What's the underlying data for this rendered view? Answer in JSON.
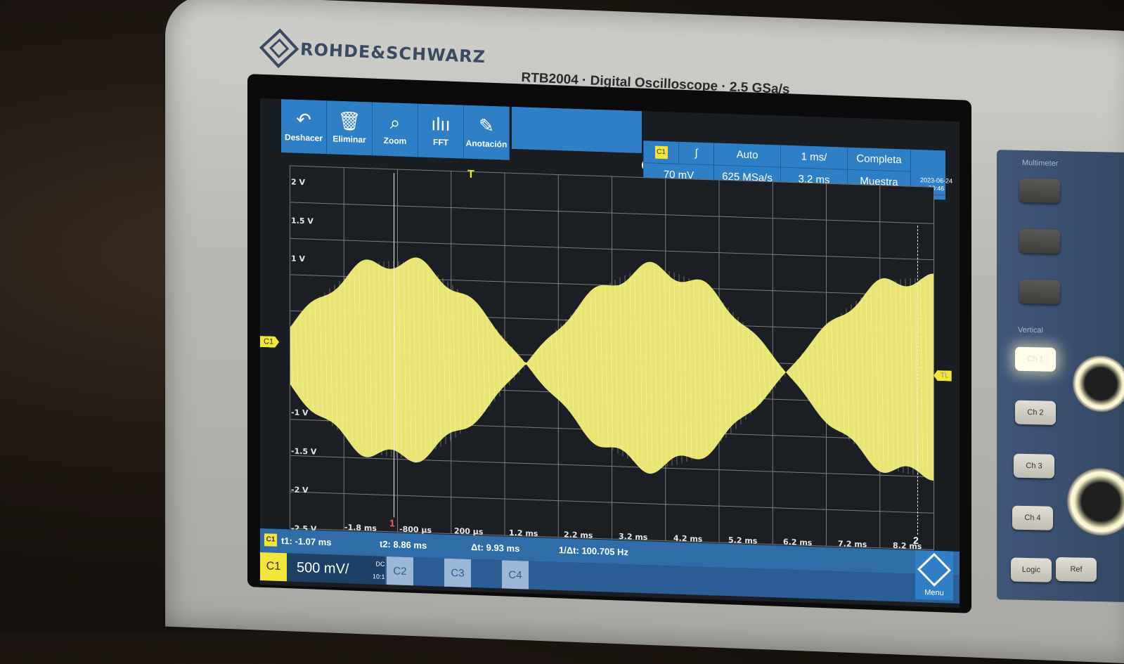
{
  "brand": {
    "name": "ROHDE&SCHWARZ",
    "model_line": "RTB2004 · Digital Oscilloscope · 2.5 GSa/s"
  },
  "toolbar": {
    "undo": {
      "label": "Deshacer",
      "icon": "undo-icon"
    },
    "delete": {
      "label": "Eliminar",
      "icon": "trash-icon"
    },
    "zoom": {
      "label": "Zoom",
      "icon": "magnifier-icon"
    },
    "fft": {
      "label": "FFT",
      "icon": "fft-icon"
    },
    "annotation": {
      "label": "Anotación",
      "icon": "pencil-icon"
    }
  },
  "settings": {
    "trigger_source": "C1",
    "trigger_slope_icon": "rising-edge-icon",
    "trigger_level": "70 mV",
    "trigger_mode": "Auto",
    "sample_rate": "625 MSa/s",
    "timebase": "1 ms/",
    "record_length": "3.2 ms",
    "acquisition": "Completa",
    "acq_mode": "Muestra",
    "date": "2023-06-24",
    "time": "00:46"
  },
  "grid": {
    "y_labels": [
      "2 V",
      "1.5 V",
      "1 V",
      "-1 V",
      "-1.5 V",
      "-2 V",
      "-2.5 V"
    ],
    "x_labels": [
      "-1.8 ms",
      "-800 µs",
      "200 µs",
      "1.2 ms",
      "2.2 ms",
      "3.2 ms",
      "4.2 ms",
      "5.2 ms",
      "6.2 ms",
      "7.2 ms",
      "8.2 ms"
    ],
    "channel_marker": "C1",
    "trigger_level_marker": "TL",
    "trigger_position_marker": "T",
    "cursor1_label": "1",
    "cursor2_label": "2",
    "trace_color": "#f3f07a"
  },
  "cursor_info": {
    "channel": "C1",
    "t1": "t1: -1.07 ms",
    "t2": "t2: 8.86 ms",
    "dt": "Δt: 9.93 ms",
    "freq": "1/Δt: 100.705 Hz"
  },
  "channels": {
    "c1": {
      "label": "C1",
      "scale": "500 mV/",
      "coupling": "DC",
      "probe": "10:1",
      "color": "#f3e63a"
    },
    "c2": {
      "label": "C2"
    },
    "c3": {
      "label": "C3"
    },
    "c4": {
      "label": "C4"
    },
    "menu": "Menu"
  },
  "hardware": {
    "multimeter_label": "Multimeter",
    "vertical_label": "Vertical",
    "ch1": "Ch 1",
    "ch2": "Ch 2",
    "ch3": "Ch 3",
    "ch4": "Ch 4",
    "logic": "Logic",
    "ref": "Ref"
  }
}
